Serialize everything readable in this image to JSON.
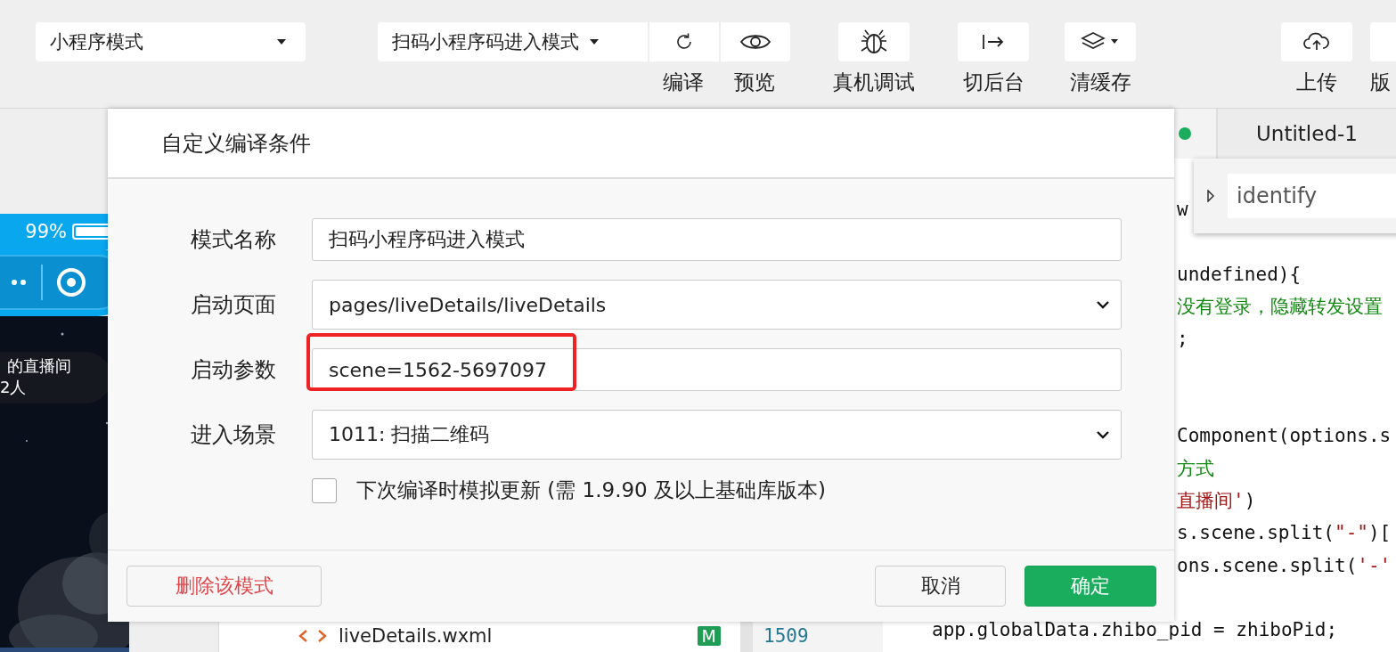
{
  "toolbar": {
    "mode_select": {
      "value": "小程序模式"
    },
    "compile_select": {
      "value": "扫码小程序码进入模式"
    },
    "tools": [
      {
        "kind": "compile",
        "label": "编译"
      },
      {
        "kind": "preview",
        "label": "预览"
      },
      {
        "kind": "debug",
        "label": "真机调试"
      },
      {
        "kind": "background",
        "label": "切后台"
      },
      {
        "kind": "cache",
        "label": "清缓存"
      },
      {
        "kind": "upload",
        "label": "上传"
      },
      {
        "kind": "version",
        "label": "版"
      }
    ]
  },
  "simulator": {
    "battery_text": "99%",
    "room_title": "的直播间",
    "viewers": "2人"
  },
  "file_tree": {
    "rows": [
      {
        "name": "liveDetails.wxml",
        "badge": "M"
      }
    ]
  },
  "editor": {
    "line_numbers": [
      "1509"
    ],
    "tab": {
      "label": "Untitled-1",
      "saved": true
    },
    "search": {
      "value": "identify"
    },
    "code_right_of_dialog": [
      [
        {
          "kind": "plain",
          "text": "w"
        }
      ],
      [
        {
          "kind": "plain",
          "text": "undefined){"
        }
      ],
      [
        {
          "kind": "comment",
          "text": "没有登录，隐藏转发设置"
        }
      ],
      [
        {
          "kind": "plain",
          "text": ";"
        }
      ],
      [
        {
          "kind": "plain",
          "text": "Component(options.s"
        }
      ],
      [
        {
          "kind": "comment",
          "text": "方式"
        }
      ],
      [
        {
          "kind": "string",
          "text": "直播间'"
        },
        {
          "kind": "plain",
          "text": ")"
        }
      ],
      [
        {
          "kind": "plain",
          "text": "s.scene.split("
        },
        {
          "kind": "string",
          "text": "\"-\""
        },
        {
          "kind": "plain",
          "text": ")["
        }
      ],
      [
        {
          "kind": "plain",
          "text": "ons.scene.split("
        },
        {
          "kind": "string",
          "text": "'-'"
        }
      ]
    ],
    "code_below_dialog": [
      [
        {
          "kind": "plain",
          "text": "app.globalData.zhibo_pid = zhiboPid;"
        }
      ]
    ]
  },
  "dialog": {
    "title": "自定义编译条件",
    "fields": [
      {
        "kind": "text",
        "label": "模式名称",
        "value": "扫码小程序码进入模式",
        "highlighted": false
      },
      {
        "kind": "select",
        "label": "启动页面",
        "value": "pages/liveDetails/liveDetails",
        "highlighted": false
      },
      {
        "kind": "text",
        "label": "启动参数",
        "value": "scene=1562-5697097",
        "highlighted": true
      },
      {
        "kind": "select",
        "label": "进入场景",
        "value": "1011: 扫描二维码",
        "highlighted": false
      }
    ],
    "checkbox": {
      "label": "下次编译时模拟更新 (需 1.9.90 及以上基础库版本)",
      "checked": false
    },
    "delete_button": "删除该模式",
    "cancel_button": "取消",
    "confirm_button": "确定"
  }
}
